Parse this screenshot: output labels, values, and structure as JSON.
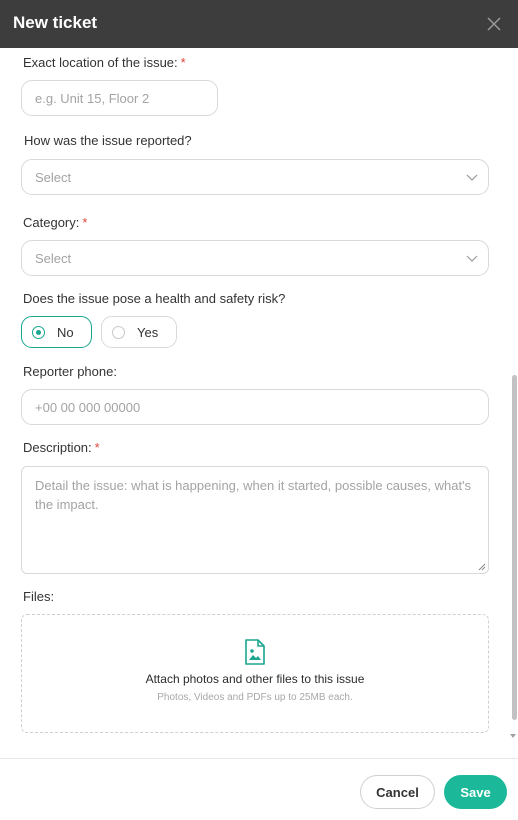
{
  "header": {
    "title": "New ticket",
    "close_icon": "close-icon"
  },
  "form": {
    "location": {
      "label": "Exact location of the issue:",
      "required_mark": "*",
      "placeholder": "e.g. Unit 15, Floor 2"
    },
    "reported": {
      "label": "How was the issue reported?",
      "placeholder": "Select"
    },
    "category": {
      "label": "Category:",
      "required_mark": "*",
      "placeholder": "Select"
    },
    "health_safety": {
      "label": "Does the issue pose a health and safety risk?",
      "options": [
        "No",
        "Yes"
      ],
      "selected": "No"
    },
    "phone": {
      "label": "Reporter phone:",
      "placeholder": "+00 00 000 00000"
    },
    "description": {
      "label": "Description:",
      "required_mark": "*",
      "placeholder": "Detail the issue: what is happening, when it started, possible causes, what's the impact."
    },
    "files": {
      "label": "Files:",
      "title": "Attach photos and other files to this issue",
      "subtitle": "Photos, Videos and PDFs up to 25MB each.",
      "icon": "image-file-icon"
    }
  },
  "footer": {
    "cancel_label": "Cancel",
    "save_label": "Save"
  },
  "colors": {
    "header_bg": "#3d3d3d",
    "accent": "#1bb99a",
    "required": "#e0453a"
  }
}
